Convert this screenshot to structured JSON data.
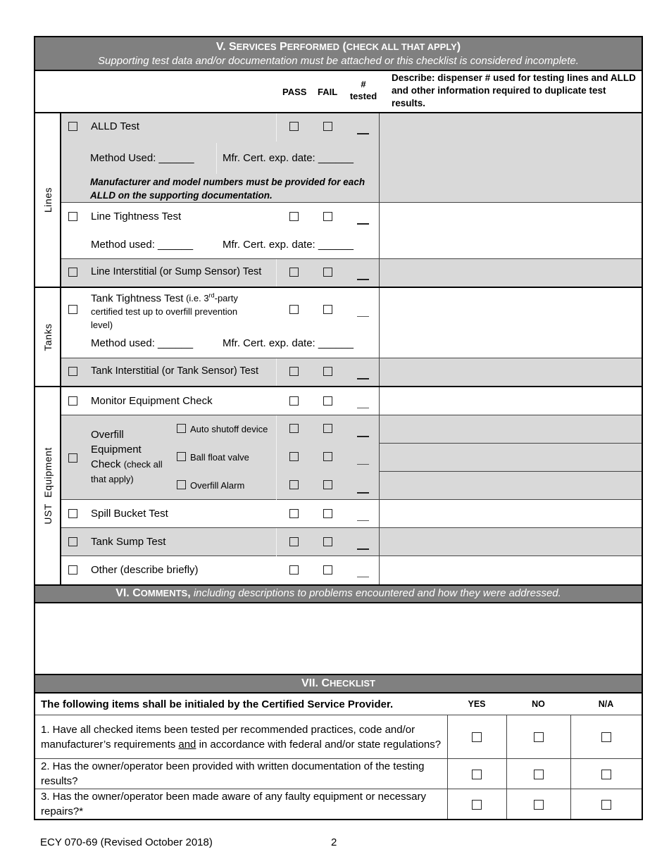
{
  "section5": {
    "title_prefix": "V. S",
    "title_rest": "ERVICES ",
    "title_p": "P",
    "title_erformed": "ERFORMED (",
    "title_caps": "CHECK ALL THAT APPLY",
    "title_close": ")",
    "title_full": "V. Services Performed (check all that apply)",
    "subtitle": "Supporting test data and/or documentation must be attached or this checklist is considered incomplete.",
    "columns": {
      "pass": "PASS",
      "fail": "FAIL",
      "num_tested_line1": "#",
      "num_tested_line2": "tested",
      "describe": "Describe: dispenser # used for testing lines and ALLD and other information required to duplicate test results."
    },
    "groups": [
      {
        "label": "Lines",
        "items": [
          {
            "name": "ALLD Test",
            "method_label": "Method Used: ______",
            "cert_label": "Mfr. Cert. exp. date: ______",
            "note": "Manufacturer and model numbers must be provided for each ALLD on the supporting documentation."
          },
          {
            "name": "Line Tightness Test",
            "method_label": "Method used: ______",
            "cert_label": "Mfr. Cert. exp. date: ______"
          },
          {
            "name": "Line Interstitial (or Sump Sensor) Test"
          }
        ]
      },
      {
        "label": "Tanks",
        "items": [
          {
            "name": "Tank Tightness Test",
            "name_suffix_a": " (i.e. 3",
            "name_sup": "rd",
            "name_suffix_b": "-party",
            "line2": "certified test up to overfill prevention",
            "line3": "level)",
            "method_label": "Method used: ______",
            "cert_label": "Mfr. Cert. exp. date: ______"
          },
          {
            "name": "Tank Interstitial (or Tank Sensor) Test"
          }
        ]
      },
      {
        "label": "UST  Equipment",
        "items": [
          {
            "name": "Monitor Equipment Check"
          },
          {
            "name_l1": "Overfill",
            "name_l2": "Equipment",
            "name_l3": "Check ",
            "name_l3_small": "(check all",
            "name_l4": "that apply)",
            "sub_items": [
              "Auto shutoff device",
              "Ball float valve",
              "Overfill Alarm"
            ]
          },
          {
            "name": "Spill Bucket Test"
          },
          {
            "name": "Tank Sump Test"
          },
          {
            "name": "Other (describe briefly)"
          }
        ]
      }
    ]
  },
  "section6": {
    "title_bold": "VI. C",
    "title_sc": "OMMENTS",
    "title_comma": ",",
    "title_italic": " including descriptions to problems encountered and how they were addressed.",
    "comments_value": ""
  },
  "section7": {
    "title_bold": "VII. C",
    "title_sc": "HECKLIST",
    "instruction": "The following items shall be initialed by the Certified Service Provider.",
    "col_yes": "YES",
    "col_no": "NO",
    "col_na": "N/A",
    "questions": [
      {
        "pre": "1. Have all checked items been tested per recommended practices, code and/or manufacturer’s requirements ",
        "u": "and",
        "post": " in accordance with federal and/or state regulations?"
      },
      {
        "pre": "2. Has the owner/operator been provided with written documentation of the testing results?",
        "u": "",
        "post": ""
      },
      {
        "pre": "3. Has the owner/operator been made aware of any faulty equipment or necessary repairs?*",
        "u": "",
        "post": ""
      }
    ]
  },
  "footer": {
    "form_id": "ECY 070-69 (Revised October 2018)",
    "page_number": "2"
  },
  "colors": {
    "header_bg": "#808080",
    "row_shade": "#d9d9d9"
  }
}
